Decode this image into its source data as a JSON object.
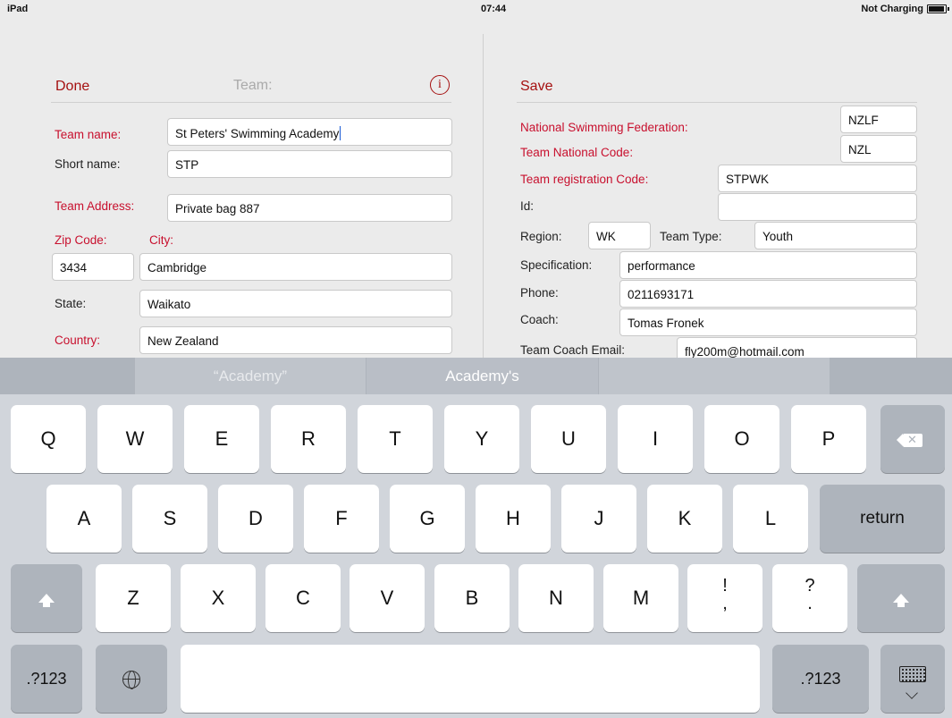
{
  "status_bar": {
    "device": "iPad",
    "time": "07:44",
    "battery_status": "Not Charging"
  },
  "left_panel": {
    "done_label": "Done",
    "title": "Team:",
    "fields": {
      "team_name": {
        "label": "Team name:",
        "value": "St Peters' Swimming Academy"
      },
      "short_name": {
        "label": "Short name:",
        "value": "STP"
      },
      "team_address": {
        "label": "Team Address:",
        "value": "Private bag 887"
      },
      "zip_code": {
        "label": "Zip Code:",
        "value": "3434"
      },
      "city": {
        "label": "City:",
        "value": "Cambridge"
      },
      "state": {
        "label": "State:",
        "value": "Waikato"
      },
      "country": {
        "label": "Country:",
        "value": "New Zealand"
      }
    }
  },
  "right_panel": {
    "save_label": "Save",
    "fields": {
      "national_federation": {
        "label": "National Swimming Federation:",
        "value": "NZLF"
      },
      "team_national_code": {
        "label": "Team National Code:",
        "value": "NZL"
      },
      "team_registration_code": {
        "label": "Team registration Code:",
        "value": "STPWK"
      },
      "id": {
        "label": "Id:",
        "value": ""
      },
      "region": {
        "label": "Region:",
        "value": "WK"
      },
      "team_type": {
        "label": "Team Type:",
        "value": "Youth"
      },
      "specification": {
        "label": "Specification:",
        "value": "performance"
      },
      "phone": {
        "label": "Phone:",
        "value": "0211693171"
      },
      "coach": {
        "label": "Coach:",
        "value": "Tomas Fronek"
      },
      "team_coach_email": {
        "label": "Team Coach Email:",
        "value": "fly200m@hotmail.com"
      }
    }
  },
  "keyboard": {
    "predictions": [
      "“Academy”",
      "Academy's",
      ""
    ],
    "row1": [
      "Q",
      "W",
      "E",
      "R",
      "T",
      "Y",
      "U",
      "I",
      "O",
      "P"
    ],
    "row2": [
      "A",
      "S",
      "D",
      "F",
      "G",
      "H",
      "J",
      "K",
      "L"
    ],
    "row3": [
      "Z",
      "X",
      "C",
      "V",
      "B",
      "N",
      "M"
    ],
    "punct1": {
      "top": "!",
      "bottom": ","
    },
    "punct2": {
      "top": "?",
      "bottom": "."
    },
    "return_label": "return",
    "numbers_label": ".?123",
    "icons": {
      "backspace": "backspace-icon",
      "shift": "shift-icon",
      "globe": "globe-icon",
      "dismiss": "keyboard-dismiss-icon",
      "info": "info-icon"
    }
  }
}
